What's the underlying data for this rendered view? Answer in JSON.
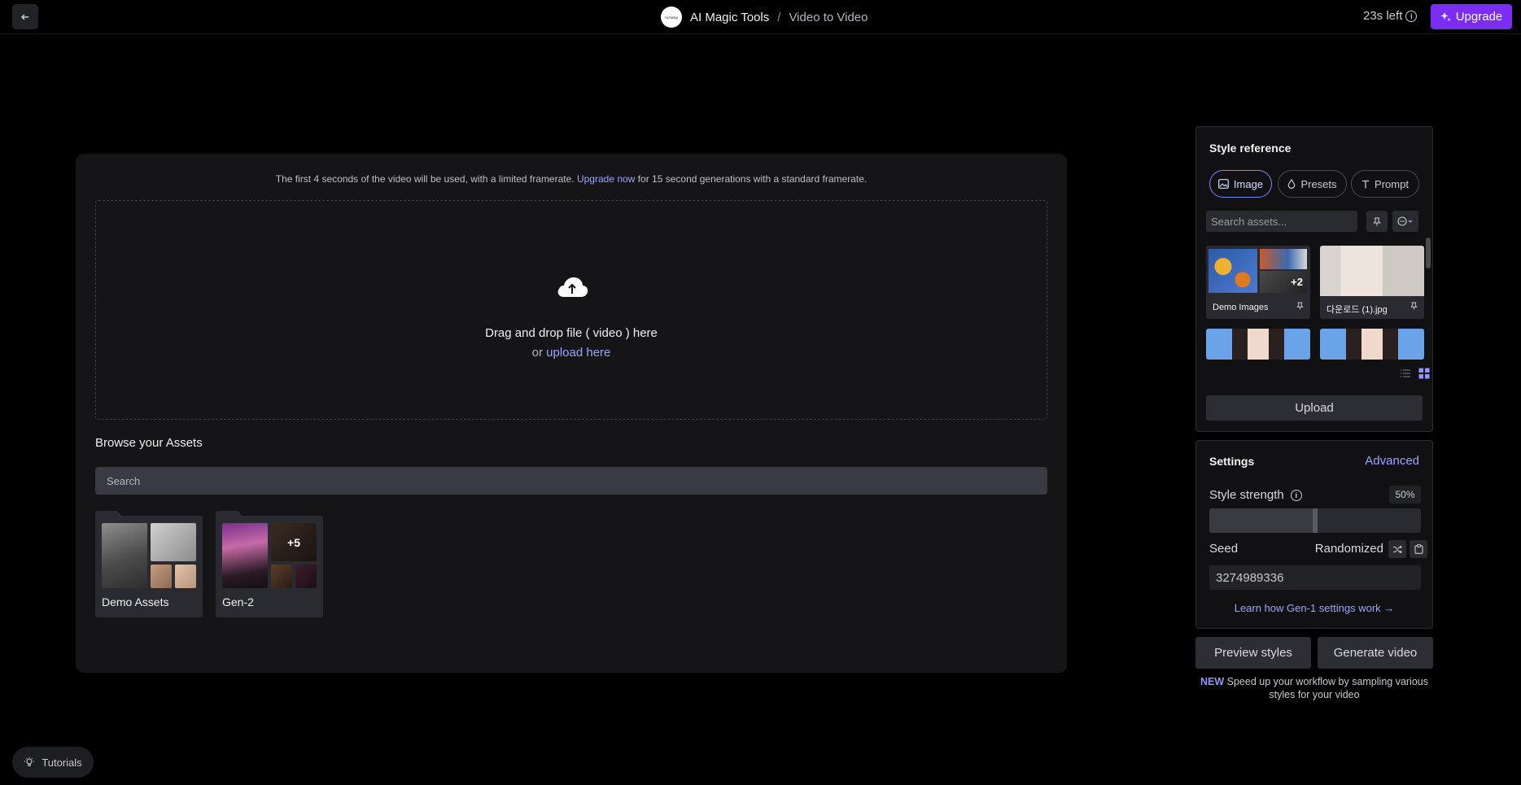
{
  "header": {
    "back_icon": "arrow-left-icon",
    "app_title": "AI Magic Tools",
    "separator": "/",
    "page_title": "Video to Video",
    "time_left": "23s left",
    "upgrade_label": "Upgrade",
    "accent_color": "#7b2cf5"
  },
  "main": {
    "notice_prefix": "The first 4 seconds of the video will be used, with a limited framerate.",
    "notice_link": "Upgrade now",
    "notice_suffix": "for 15 second generations with a standard framerate.",
    "drop_title": "Drag and drop file ( video ) here",
    "drop_or": "or",
    "drop_link": "upload here",
    "browse_title": "Browse your Assets",
    "search_placeholder": "Search",
    "folders": [
      {
        "label": "Demo Assets",
        "extra": ""
      },
      {
        "label": "Gen-2",
        "extra": "+5"
      }
    ]
  },
  "style_reference": {
    "title": "Style reference",
    "tabs": [
      "Image",
      "Presets",
      "Prompt"
    ],
    "active_tab": "Image",
    "search_placeholder": "Search assets...",
    "assets": [
      {
        "name": "Demo Images",
        "extra": "+2"
      },
      {
        "name": "다운로드 (1).jpg",
        "extra": ""
      }
    ],
    "upload_label": "Upload"
  },
  "settings": {
    "title": "Settings",
    "advanced_label": "Advanced",
    "style_strength_label": "Style strength",
    "style_strength_value": "50%",
    "style_strength_fraction": 0.5,
    "seed_label": "Seed",
    "randomized_label": "Randomized",
    "seed_value": "3274989336",
    "learn_link": "Learn how Gen-1 settings work →"
  },
  "actions": {
    "preview_label": "Preview styles",
    "generate_label": "Generate video",
    "new_tag": "NEW",
    "new_text": "Speed up your workflow by sampling various styles for your video"
  },
  "footer": {
    "tutorials_label": "Tutorials"
  }
}
